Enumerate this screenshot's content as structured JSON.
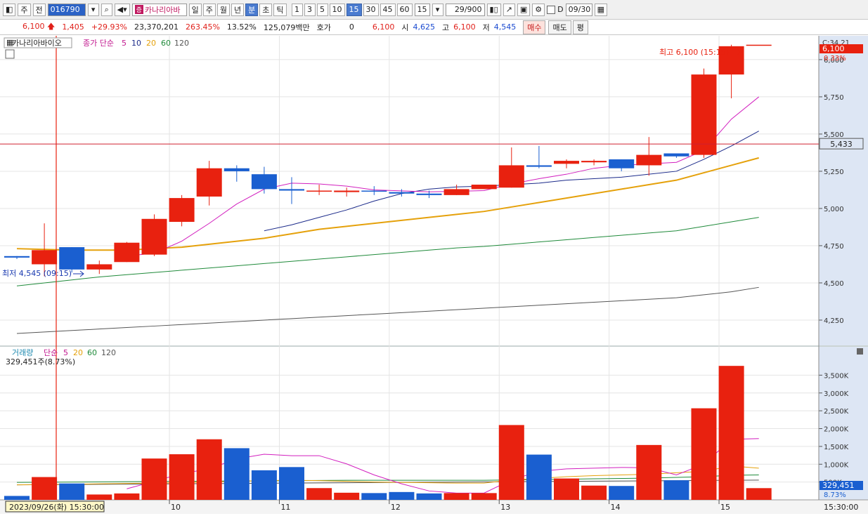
{
  "toolbar": {
    "market": "주",
    "prev_label": "전",
    "code": "016790",
    "stock_name": "카나리아바",
    "period_buttons": [
      "일",
      "주",
      "월",
      "년",
      "분",
      "초",
      "틱"
    ],
    "interval_buttons": [
      "1",
      "3",
      "5",
      "10",
      "15",
      "30",
      "45",
      "60"
    ],
    "interval_select": "15",
    "count": "29",
    "count_total": "/900",
    "checkbox_label": "D",
    "date": "09/30"
  },
  "infobar": {
    "price": "6,100",
    "change": "1,405",
    "change_pct": "+29.93%",
    "volume": "23,370,201",
    "vol_ratio": "263.45%",
    "turnover": "13.52%",
    "amount": "125,079백만",
    "hoga_label": "호가",
    "hoga_value": "0",
    "hoga_price": "6,100",
    "open_label": "시",
    "open": "4,625",
    "high_label": "고",
    "high": "6,100",
    "low_label": "저",
    "low": "4,545",
    "buy_label": "매수",
    "sell_label": "매도",
    "avg_label": "평"
  },
  "price_panel": {
    "stock_tag": "카나리아바이오",
    "indicator_label": "종가 단순",
    "ma_periods": [
      "5",
      "10",
      "20",
      "60",
      "120"
    ],
    "high_annotation": "최고 6,100 (15:15)",
    "low_annotation": "최저 4,545 (09:15)",
    "right_badge_top": "C:34.21",
    "right_price": "6,100",
    "right_pct": "0.33%",
    "crosshair_value": "5,433",
    "y_ticks": [
      "6,000",
      "5,750",
      "5,500",
      "5,250",
      "5,000",
      "4,750",
      "4,500",
      "4,250"
    ]
  },
  "volume_panel": {
    "label": "거래량",
    "indicator_label": "단순",
    "ma_periods": [
      "5",
      "20",
      "60",
      "120"
    ],
    "current": "329,451주(8.73%)",
    "right_value": "329,451",
    "right_pct": "8.73%",
    "y_ticks": [
      "3,500K",
      "3,000K",
      "2,500K",
      "2,000K",
      "1,500K",
      "1,000K",
      "500K"
    ]
  },
  "x_axis": {
    "labels": [
      "10",
      "11",
      "12",
      "13",
      "14",
      "15"
    ],
    "cursor_label": "2023/09/26(화) 15:30:00",
    "end_label": "15:30:00"
  },
  "colors": {
    "up": "#e8210f",
    "down": "#1a5fd0",
    "ma5": "#d21fbf",
    "ma10": "#1b2a8a",
    "ma20": "#e5a10b",
    "ma60": "#1f8a3a",
    "ma120": "#555555"
  },
  "chart_data": {
    "type": "candlestick",
    "candles": [
      {
        "o": 4680,
        "h": 4680,
        "l": 4660,
        "c": 4670
      },
      {
        "o": 4625,
        "h": 4900,
        "l": 4545,
        "c": 4720
      },
      {
        "o": 4740,
        "h": 4740,
        "l": 4570,
        "c": 4590
      },
      {
        "o": 4590,
        "h": 4650,
        "l": 4560,
        "c": 4625
      },
      {
        "o": 4640,
        "h": 4775,
        "l": 4640,
        "c": 4770
      },
      {
        "o": 4690,
        "h": 4960,
        "l": 4680,
        "c": 4930
      },
      {
        "o": 4910,
        "h": 5090,
        "l": 4880,
        "c": 5070
      },
      {
        "o": 5080,
        "h": 5320,
        "l": 5020,
        "c": 5270
      },
      {
        "o": 5270,
        "h": 5290,
        "l": 5180,
        "c": 5250
      },
      {
        "o": 5230,
        "h": 5280,
        "l": 5100,
        "c": 5130
      },
      {
        "o": 5130,
        "h": 5210,
        "l": 5030,
        "c": 5120
      },
      {
        "o": 5120,
        "h": 5160,
        "l": 5090,
        "c": 5120
      },
      {
        "o": 5110,
        "h": 5140,
        "l": 5080,
        "c": 5120
      },
      {
        "o": 5120,
        "h": 5150,
        "l": 5090,
        "c": 5115
      },
      {
        "o": 5110,
        "h": 5130,
        "l": 5080,
        "c": 5100
      },
      {
        "o": 5100,
        "h": 5120,
        "l": 5070,
        "c": 5090
      },
      {
        "o": 5090,
        "h": 5160,
        "l": 5090,
        "c": 5130
      },
      {
        "o": 5130,
        "h": 5160,
        "l": 5130,
        "c": 5160
      },
      {
        "o": 5140,
        "h": 5410,
        "l": 5140,
        "c": 5290
      },
      {
        "o": 5290,
        "h": 5420,
        "l": 5270,
        "c": 5280
      },
      {
        "o": 5300,
        "h": 5330,
        "l": 5270,
        "c": 5320
      },
      {
        "o": 5310,
        "h": 5330,
        "l": 5290,
        "c": 5320
      },
      {
        "o": 5330,
        "h": 5330,
        "l": 5250,
        "c": 5270
      },
      {
        "o": 5290,
        "h": 5480,
        "l": 5220,
        "c": 5360
      },
      {
        "o": 5370,
        "h": 5370,
        "l": 5340,
        "c": 5350
      },
      {
        "o": 5360,
        "h": 5940,
        "l": 5340,
        "c": 5900
      },
      {
        "o": 5900,
        "h": 6100,
        "l": 5740,
        "c": 6090
      },
      {
        "o": 6100,
        "h": 6100,
        "l": 6100,
        "c": 6100
      }
    ],
    "volumes": [
      110,
      640,
      460,
      150,
      180,
      1160,
      1280,
      1700,
      1450,
      830,
      920,
      330,
      200,
      190,
      220,
      180,
      190,
      190,
      2100,
      1270,
      600,
      400,
      390,
      1540,
      550,
      2570,
      3760,
      329
    ],
    "ma_price": {
      "ma5": [
        null,
        null,
        null,
        null,
        4680,
        4700,
        4780,
        4900,
        5030,
        5130,
        5170,
        5165,
        5150,
        5125,
        5118,
        5112,
        5115,
        5120,
        5165,
        5200,
        5230,
        5270,
        5290,
        5300,
        5310,
        5390,
        5600,
        5750
      ],
      "ma10": [
        null,
        null,
        null,
        null,
        null,
        null,
        null,
        null,
        null,
        4850,
        4890,
        4940,
        4990,
        5050,
        5100,
        5130,
        5145,
        5150,
        5160,
        5170,
        5190,
        5200,
        5210,
        5230,
        5250,
        5330,
        5420,
        5520
      ],
      "ma20": [
        4730,
        4725,
        4720,
        4720,
        4720,
        4730,
        4740,
        4760,
        4780,
        4800,
        4830,
        4860,
        4880,
        4900,
        4920,
        4940,
        4960,
        4980,
        5010,
        5040,
        5070,
        5100,
        5130,
        5160,
        5190,
        5240,
        5290,
        5340
      ],
      "ma60": [
        4480,
        4500,
        4520,
        4540,
        4555,
        4570,
        4585,
        4600,
        4615,
        4630,
        4645,
        4660,
        4675,
        4690,
        4705,
        4720,
        4735,
        4745,
        4760,
        4775,
        4790,
        4805,
        4820,
        4835,
        4850,
        4880,
        4910,
        4940
      ],
      "ma120": [
        4160,
        4170,
        4180,
        4190,
        4200,
        4210,
        4220,
        4230,
        4240,
        4250,
        4260,
        4270,
        4280,
        4290,
        4300,
        4310,
        4320,
        4330,
        4340,
        4350,
        4360,
        4370,
        4380,
        4390,
        4400,
        4420,
        4440,
        4470
      ]
    },
    "ma_volume": {
      "ma5": [
        null,
        null,
        null,
        null,
        310,
        520,
        740,
        870,
        1150,
        1280,
        1240,
        1240,
        1010,
        700,
        450,
        250,
        190,
        190,
        560,
        800,
        870,
        890,
        910,
        900,
        700,
        1000,
        1700,
        1720
      ],
      "ma20": [
        420,
        430,
        440,
        450,
        460,
        470,
        480,
        500,
        520,
        540,
        550,
        540,
        520,
        500,
        490,
        480,
        470,
        470,
        560,
        600,
        650,
        680,
        700,
        720,
        760,
        800,
        950,
        890
      ],
      "ma60": [
        490,
        495,
        500,
        505,
        510,
        515,
        520,
        525,
        530,
        535,
        540,
        545,
        550,
        550,
        550,
        550,
        550,
        550,
        560,
        570,
        580,
        590,
        600,
        610,
        630,
        650,
        690,
        700
      ],
      "ma120": [
        420,
        425,
        430,
        435,
        440,
        445,
        450,
        455,
        460,
        465,
        470,
        475,
        480,
        485,
        490,
        495,
        500,
        505,
        510,
        515,
        520,
        525,
        530,
        535,
        540,
        545,
        550,
        555
      ]
    },
    "price_range": [
      4080,
      6160
    ],
    "volume_range": [
      0,
      4000
    ],
    "xlabel": "",
    "ylabel": ""
  }
}
